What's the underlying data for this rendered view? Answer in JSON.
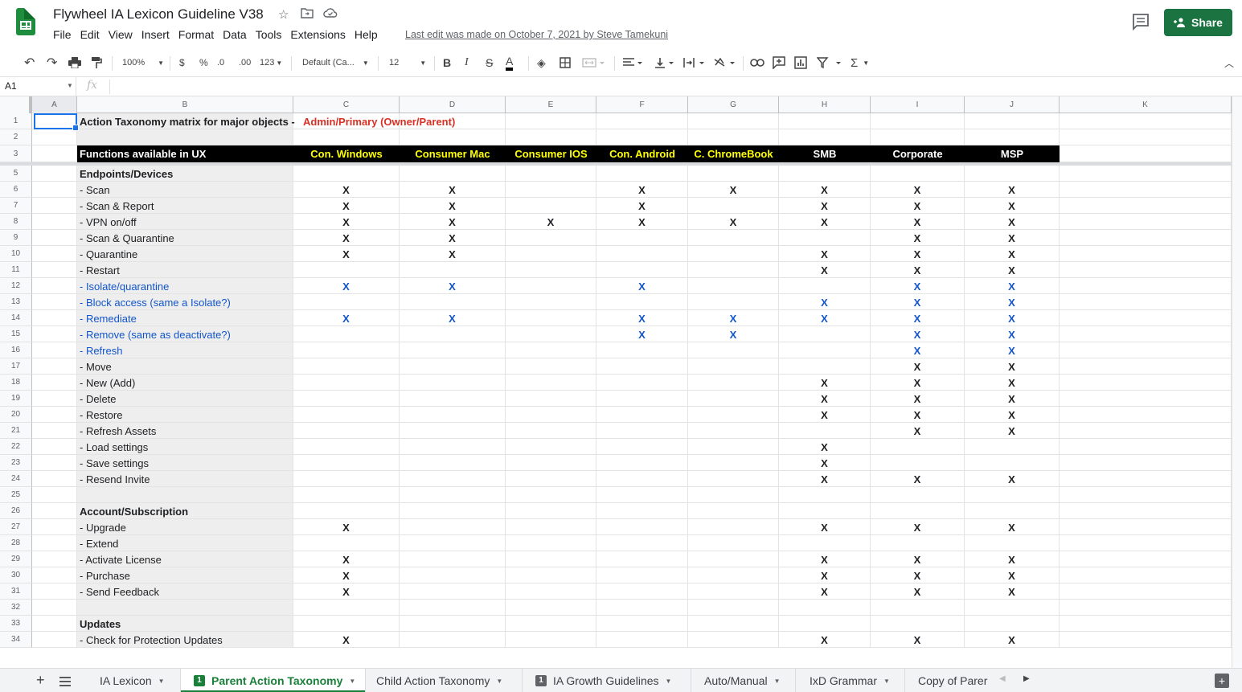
{
  "header": {
    "title": "Flywheel IA Lexicon Guideline V38",
    "menu": [
      "File",
      "Edit",
      "View",
      "Insert",
      "Format",
      "Data",
      "Tools",
      "Extensions",
      "Help"
    ],
    "last_edit": "Last edit was made on October 7, 2021 by Steve Tamekuni",
    "share_label": "Share",
    "icons": [
      "star-icon",
      "move-to-folder-icon",
      "cloud-saved-icon",
      "comments-icon"
    ]
  },
  "toolbar": {
    "zoom": "100%",
    "currency": "$",
    "percent": "%",
    "decrease_decimal": ".0",
    "increase_decimal": ".00",
    "more_formats": "123",
    "font": "Default (Ca...",
    "font_size": "12",
    "bold": "B",
    "italic": "I",
    "strike": "S",
    "text_color": "A",
    "functions": "Σ"
  },
  "formula_bar": {
    "cell_ref": "A1",
    "fx": "fx"
  },
  "columns": [
    "A",
    "B",
    "C",
    "D",
    "E",
    "F",
    "G",
    "H",
    "I",
    "J",
    "K"
  ],
  "sheet": {
    "title_black": "Action Taxonomy matrix for major objects - ",
    "title_red": "Admin/Primary (Owner/Parent)",
    "header_row": [
      "Functions available in UX",
      "Con. Windows",
      "Consumer Mac",
      "Consumer IOS",
      "Con. Android",
      "C. ChromeBook",
      "SMB",
      "Corporate",
      "MSP"
    ],
    "rows": [
      {
        "n": "5",
        "label": "Endpoints/Devices",
        "section": true,
        "x": ""
      },
      {
        "n": "6",
        "label": "- Scan",
        "x": "XX.XXXXX"
      },
      {
        "n": "7",
        "label": "- Scan & Report",
        "x": "XX.X.XXX"
      },
      {
        "n": "8",
        "label": "- VPN on/off",
        "x": "XXXXXXXX"
      },
      {
        "n": "9",
        "label": "- Scan & Quarantine",
        "x": "XX....XX"
      },
      {
        "n": "10",
        "label": "- Quarantine",
        "x": "XX...XXX"
      },
      {
        "n": "11",
        "label": "- Restart",
        "x": ".....XXX"
      },
      {
        "n": "12",
        "label": "- Isolate/quarantine",
        "blue": true,
        "x": "XX.X..XX"
      },
      {
        "n": "13",
        "label": "- Block access (same a Isolate?)",
        "blue": true,
        "x": ".....XXX"
      },
      {
        "n": "14",
        "label": "- Remediate",
        "blue": true,
        "x": "XX.XXXXX"
      },
      {
        "n": "15",
        "label": "- Remove (same as deactivate?)",
        "blue": true,
        "x": "...XX.XX"
      },
      {
        "n": "16",
        "label": "- Refresh",
        "blue": true,
        "x": "......XX"
      },
      {
        "n": "17",
        "label": "- Move",
        "x": "......XX"
      },
      {
        "n": "18",
        "label": "- New (Add)",
        "x": ".....XXX"
      },
      {
        "n": "19",
        "label": "- Delete",
        "x": ".....XXX"
      },
      {
        "n": "20",
        "label": "- Restore",
        "x": ".....XXX"
      },
      {
        "n": "21",
        "label": "- Refresh Assets",
        "x": "......XX"
      },
      {
        "n": "22",
        "label": "- Load settings",
        "x": ".....X.."
      },
      {
        "n": "23",
        "label": "- Save settings",
        "x": ".....X.."
      },
      {
        "n": "24",
        "label": "- Resend Invite",
        "x": ".....XXX"
      },
      {
        "n": "25",
        "label": "",
        "x": ""
      },
      {
        "n": "26",
        "label": "Account/Subscription",
        "section": true,
        "x": ""
      },
      {
        "n": "27",
        "label": "- Upgrade",
        "x": "X....XXX"
      },
      {
        "n": "28",
        "label": "- Extend",
        "x": ""
      },
      {
        "n": "29",
        "label": "- Activate License",
        "x": "X....XXX"
      },
      {
        "n": "30",
        "label": "- Purchase",
        "x": "X....XXX"
      },
      {
        "n": "31",
        "label": "- Send Feedback",
        "x": "X....XXX"
      },
      {
        "n": "32",
        "label": "",
        "x": ""
      },
      {
        "n": "33",
        "label": "Updates",
        "section": true,
        "x": ""
      },
      {
        "n": "34",
        "label": "- Check for Protection Updates",
        "x": "X....XXX"
      }
    ],
    "x_mark": "X"
  },
  "tabs": [
    {
      "label": "IA Lexicon"
    },
    {
      "label": "Parent Action Taxonomy",
      "active": true,
      "badge": "1"
    },
    {
      "label": "Child Action Taxonomy"
    },
    {
      "label": "IA Growth Guidelines",
      "badge": "1"
    },
    {
      "label": "Auto/Manual"
    },
    {
      "label": "IxD Grammar"
    },
    {
      "label": "Copy of Parer"
    }
  ],
  "colors": {
    "share": "#1a7340",
    "header_bg": "#000000",
    "header_text": "#ffff00",
    "title_red": "#d93025",
    "link_blue": "#1155cc",
    "active_tab": "#188038"
  }
}
